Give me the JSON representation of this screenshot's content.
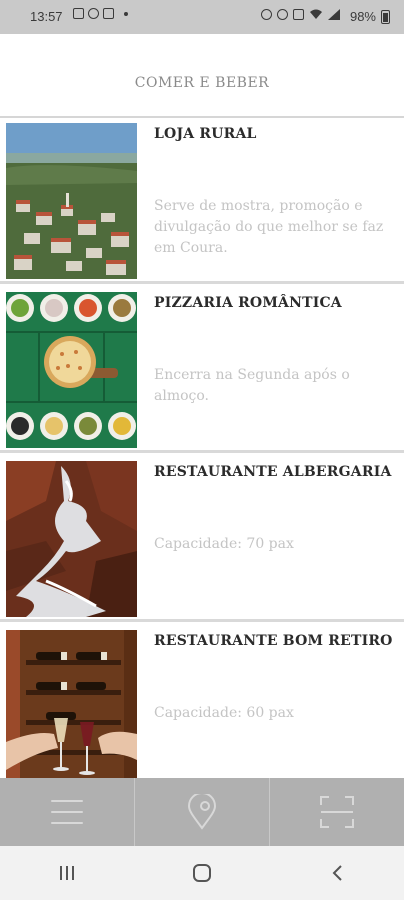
{
  "status_bar": {
    "time": "13:57",
    "battery": "98%",
    "left_icons": [
      "gallery-icon",
      "whatsapp-icon",
      "media-icon"
    ],
    "right_icons": [
      "alarm-icon",
      "clock-icon",
      "bluetooth-icon",
      "wifi-icon",
      "signal-icon"
    ]
  },
  "header": {
    "title": "COMER E BEBER"
  },
  "items": [
    {
      "title": "LOJA RURAL",
      "description": "Serve de mostra, promoção e divulgação do que melhor se faz em Coura.",
      "image": "village-landscape"
    },
    {
      "title": "PIZZARIA ROMÂNTICA",
      "description": "Encerra na Segunda após o almoço.",
      "image": "pizza-table"
    },
    {
      "title": "RESTAURANTE ALBERGARIA",
      "description": "Capacidade: 70 pax",
      "image": "waterfall"
    },
    {
      "title": "RESTAURANTE BOM RETIRO",
      "description": "Capacidade: 60 pax",
      "image": "wine-glasses"
    }
  ],
  "tabbar": {
    "tabs": [
      {
        "icon": "menu-icon"
      },
      {
        "icon": "map-pin-icon"
      },
      {
        "icon": "scan-icon"
      }
    ]
  },
  "navbar": {
    "buttons": [
      "recent-apps-icon",
      "home-icon",
      "back-icon"
    ]
  },
  "colors": {
    "tabbar": "#b0b0b0",
    "status_bar": "#c9c9c9",
    "title": "#2b2b2b",
    "description": "#c4c4c4"
  }
}
